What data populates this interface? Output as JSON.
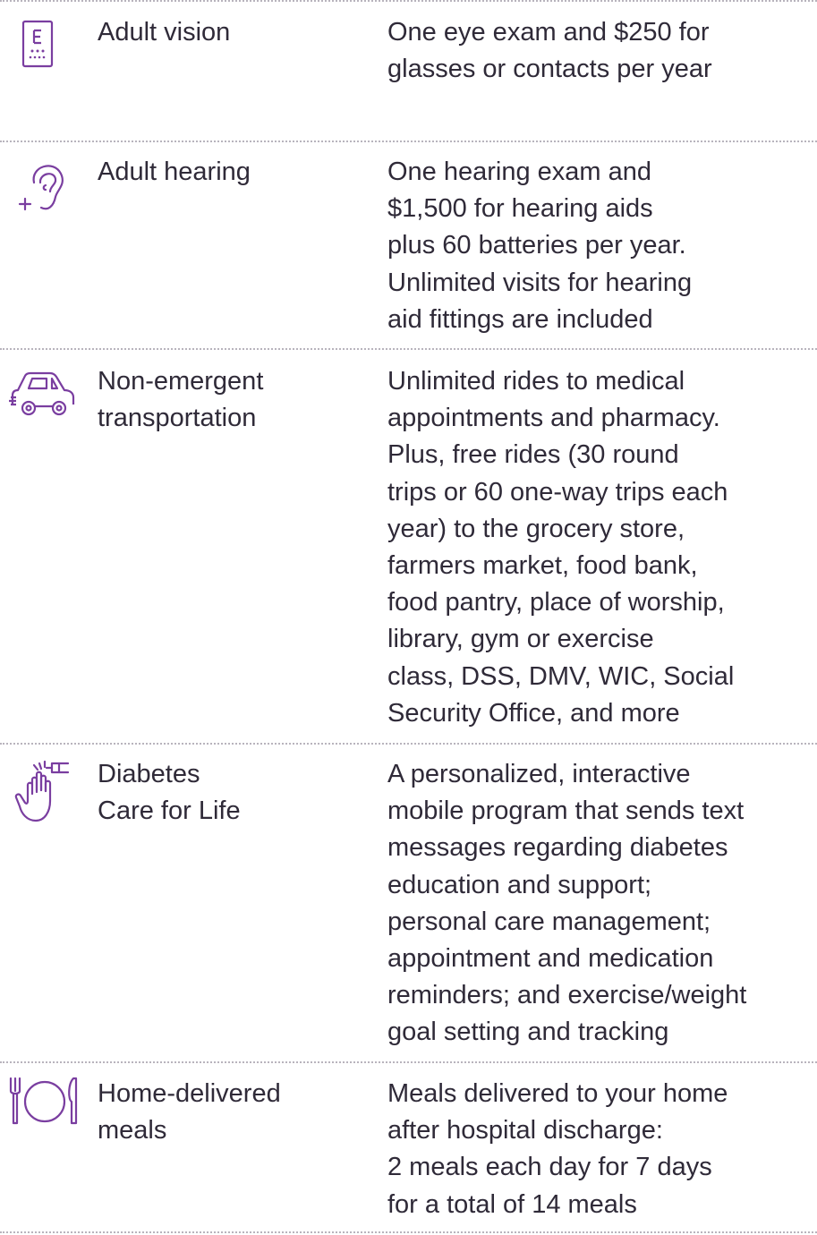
{
  "rows": [
    {
      "icon": "eye-chart-icon",
      "benefit": [
        "Adult vision"
      ],
      "description": [
        "One eye exam and $250 for",
        "glasses or contacts per year"
      ]
    },
    {
      "icon": "ear-hearing-icon",
      "benefit": [
        "Adult hearing"
      ],
      "description": [
        "One hearing exam and",
        "$1,500 for hearing aids",
        "plus 60 batteries per year.",
        "Unlimited visits for hearing",
        "aid fittings are included"
      ]
    },
    {
      "icon": "car-icon",
      "benefit": [
        "Non-emergent",
        "transportation"
      ],
      "description": [
        "Unlimited rides to medical",
        "appointments and pharmacy.",
        "Plus, free rides (30 round",
        "trips or 60 one-way trips each",
        "year) to the grocery store,",
        "farmers market, food bank,",
        "food pantry, place of worship,",
        "library, gym or exercise",
        "class, DSS, DMV, WIC, Social",
        "Security Office, and more"
      ]
    },
    {
      "icon": "hand-glucose-meter-icon",
      "benefit": [
        "Diabetes",
        "Care for Life"
      ],
      "description": [
        "A personalized, interactive",
        "mobile program that sends text",
        "messages regarding diabetes",
        "education and support;",
        "personal care management;",
        "appointment and medication",
        "reminders; and exercise/weight",
        "goal setting and tracking"
      ]
    },
    {
      "icon": "plate-fork-knife-icon",
      "benefit": [
        "Home-delivered",
        "meals"
      ],
      "description": [
        "Meals delivered to your home",
        "after hospital discharge:",
        "2 meals each day for 7 days",
        "for a total of 14 meals"
      ]
    }
  ],
  "colors": {
    "icon": "#7a3ea0",
    "text": "#2f2a38",
    "divider": "#b8b4bd"
  }
}
